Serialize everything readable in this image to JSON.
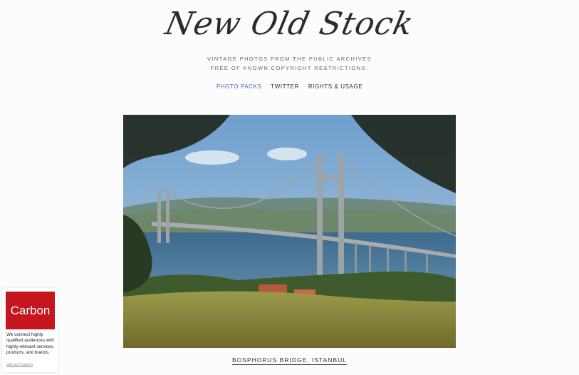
{
  "site": {
    "logo_text": "New Old Stock",
    "tagline_line1": "VINTAGE PHOTOS FROM THE PUBLIC ARCHIVES",
    "tagline_line2": "FREE OF KNOWN COPYRIGHT RESTRICTIONS."
  },
  "nav": {
    "items": [
      {
        "label": "PHOTO PACKS",
        "active": true
      },
      {
        "label": "TWITTER",
        "active": false
      },
      {
        "label": "RIGHTS & USAGE",
        "active": false
      }
    ],
    "active_color": "#4a63c8"
  },
  "photo": {
    "caption": "BOSPHORUS BRIDGE, ISTANBUL"
  },
  "ad": {
    "logo_text": "Carbon",
    "brand_color": "#c4161c",
    "text": "We connect highly qualified audiences with highly relevant services, products, and brands.",
    "via": "ads via Carbon"
  }
}
